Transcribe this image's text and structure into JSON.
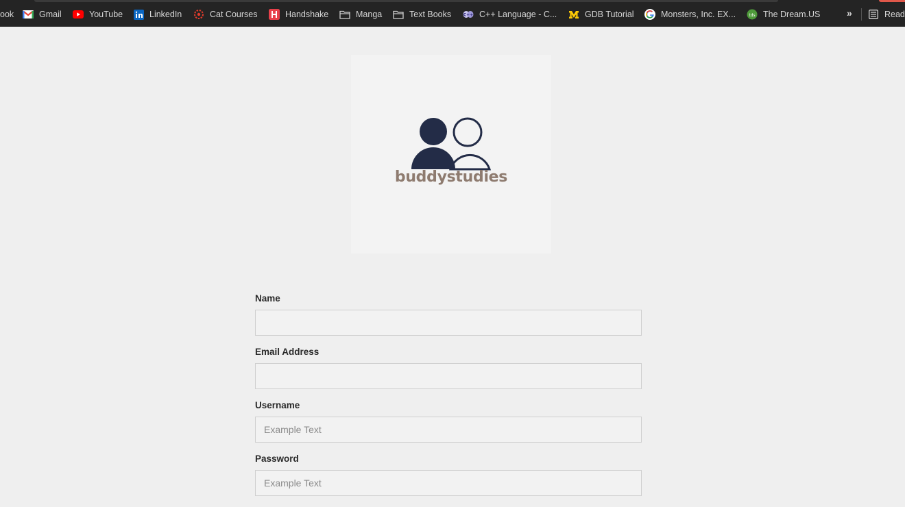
{
  "bookmarks": [
    {
      "label": "ook",
      "icon": "none"
    },
    {
      "label": "Gmail",
      "icon": "gmail-icon"
    },
    {
      "label": "YouTube",
      "icon": "youtube-icon"
    },
    {
      "label": "LinkedIn",
      "icon": "linkedin-icon"
    },
    {
      "label": "Cat Courses",
      "icon": "cat-courses-icon"
    },
    {
      "label": "Handshake",
      "icon": "handshake-icon"
    },
    {
      "label": "Manga",
      "icon": "folder-icon"
    },
    {
      "label": "Text Books",
      "icon": "folder-icon"
    },
    {
      "label": "C++ Language - C...",
      "icon": "cplusplus-icon"
    },
    {
      "label": "GDB Tutorial",
      "icon": "michigan-icon"
    },
    {
      "label": "Monsters, Inc. EX...",
      "icon": "google-icon"
    },
    {
      "label": "The Dream.US",
      "icon": "dream-us-icon"
    },
    {
      "label": "Readi",
      "icon": "reading-list-icon"
    }
  ],
  "bookmarks_more": "»",
  "logo": {
    "brand": "buddystudies",
    "colors": {
      "dark": "#232c47",
      "text": "#8e7b6f"
    }
  },
  "form": {
    "name": {
      "label": "Name",
      "value": "",
      "placeholder": ""
    },
    "email": {
      "label": "Email Address",
      "value": "",
      "placeholder": ""
    },
    "username": {
      "label": "Username",
      "value": "",
      "placeholder": "Example Text"
    },
    "password": {
      "label": "Password",
      "value": "",
      "placeholder": "Example Text"
    }
  }
}
